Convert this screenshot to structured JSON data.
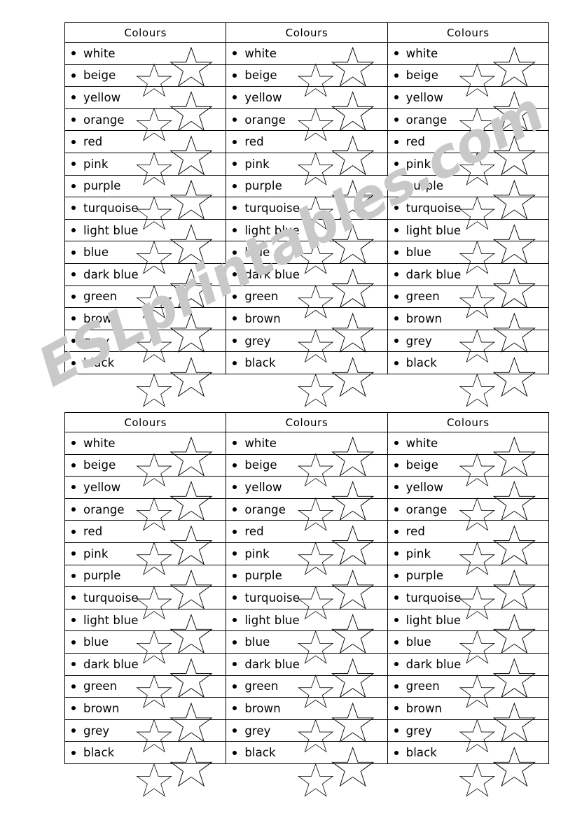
{
  "document": {
    "title": "Colours",
    "watermark": "ESLprintables.com",
    "watermark_color": "#c9c9c9",
    "page_background": "#ffffff",
    "ink_color": "#000000",
    "decoration_icon": "star-outline-icon"
  },
  "tables": [
    {
      "id": "table-1",
      "columns": [
        {
          "header": "Colours",
          "items": [
            "white",
            "beige",
            "yellow",
            "orange",
            "red",
            "pink",
            "purple",
            "turquoise",
            "light blue",
            "blue",
            "dark blue",
            "green",
            "brown",
            "grey",
            "black"
          ]
        },
        {
          "header": "Colours",
          "items": [
            "white",
            "beige",
            "yellow",
            "orange",
            "red",
            "pink",
            "purple",
            "turquoise",
            "light blue",
            "blue",
            "dark blue",
            "green",
            "brown",
            "grey",
            "black"
          ]
        },
        {
          "header": "Colours",
          "items": [
            "white",
            "beige",
            "yellow",
            "orange",
            "red",
            "pink",
            "purple",
            "turquoise",
            "light blue",
            "blue",
            "dark blue",
            "green",
            "brown",
            "grey",
            "black"
          ]
        }
      ]
    },
    {
      "id": "table-2",
      "columns": [
        {
          "header": "Colours",
          "items": [
            "white",
            "beige",
            "yellow",
            "orange",
            "red",
            "pink",
            "purple",
            "turquoise",
            "light blue",
            "blue",
            "dark blue",
            "green",
            "brown",
            "grey",
            "black"
          ]
        },
        {
          "header": "Colours",
          "items": [
            "white",
            "beige",
            "yellow",
            "orange",
            "red",
            "pink",
            "purple",
            "turquoise",
            "light blue",
            "blue",
            "dark blue",
            "green",
            "brown",
            "grey",
            "black"
          ]
        },
        {
          "header": "Colours",
          "items": [
            "white",
            "beige",
            "yellow",
            "orange",
            "red",
            "pink",
            "purple",
            "turquoise",
            "light blue",
            "blue",
            "dark blue",
            "green",
            "brown",
            "grey",
            "black"
          ]
        }
      ]
    }
  ]
}
